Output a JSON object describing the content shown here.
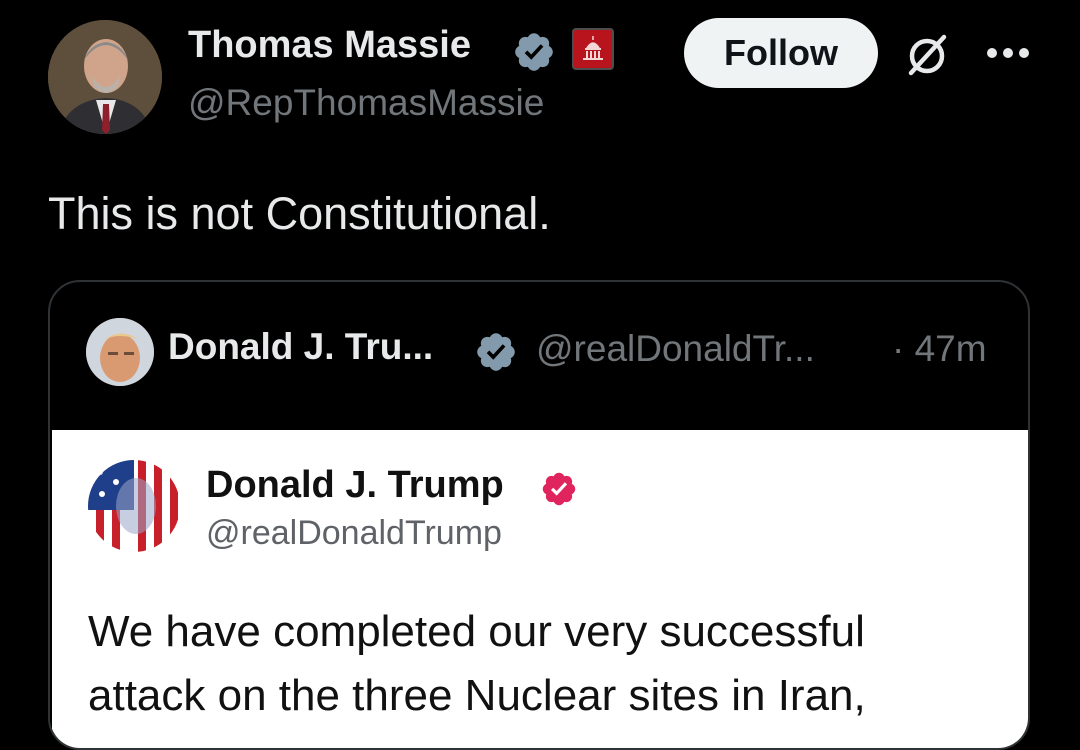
{
  "post": {
    "author_name": "Thomas Massie",
    "author_handle": "@RepThomasMassie",
    "follow_label": "Follow",
    "text": "This is not Constitutional."
  },
  "quote": {
    "author_name": "Donald J. Tru...",
    "author_handle": "@realDonaldTr...",
    "time": "· 47m",
    "embed": {
      "author_name": "Donald J. Trump",
      "author_handle": "@realDonaldTrump",
      "body_line1": "We have completed our very successful",
      "body_line2": "attack on the three Nuclear sites in Iran,"
    }
  },
  "colors": {
    "background": "#000000",
    "verified_blue_gray": "#829aab",
    "embed_badge_pink": "#e0245e",
    "gov_badge_red": "#b8141d",
    "follow_bg": "#eff3f4"
  },
  "icons": [
    "verified-icon",
    "government-badge-icon",
    "grok-icon",
    "more-icon"
  ]
}
